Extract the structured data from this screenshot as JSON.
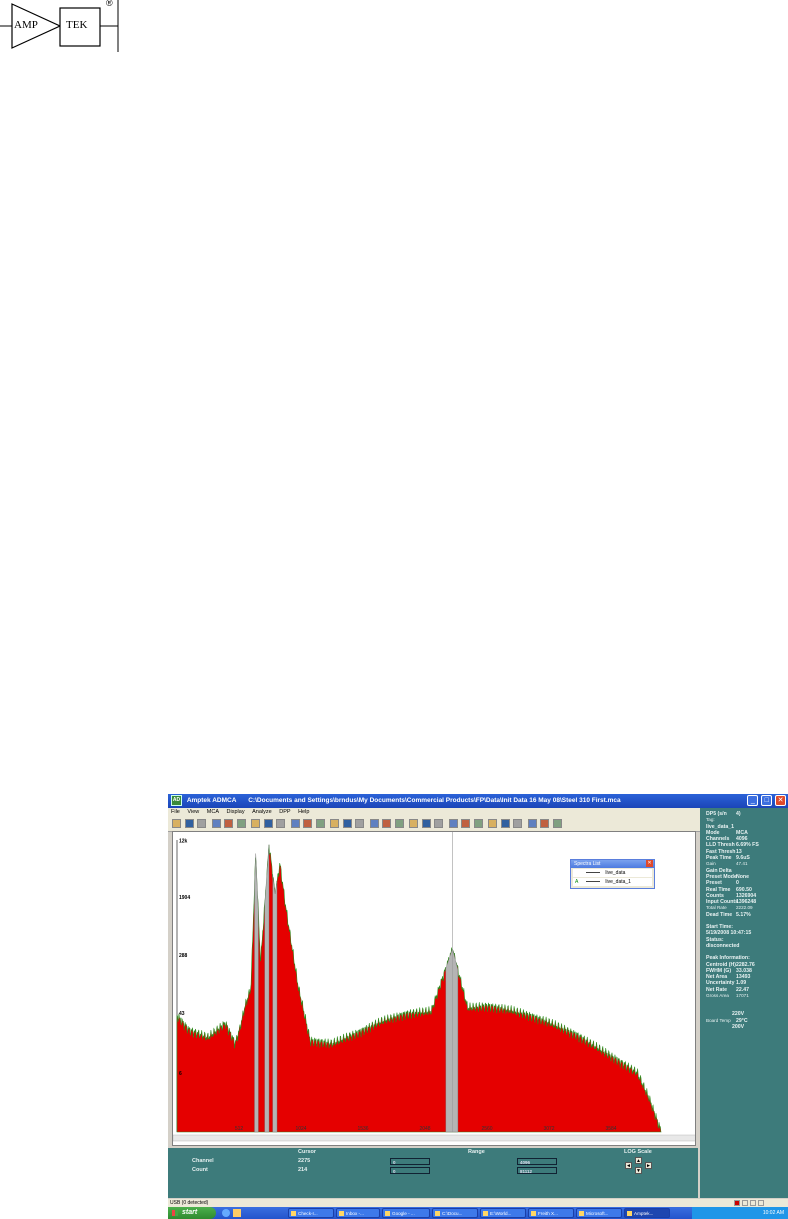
{
  "logo": {
    "left_text": "AMP",
    "right_text": "TEK",
    "registered_mark": "®"
  },
  "window": {
    "app_name": "Amptek ADMCA",
    "file_path": "C:\\Documents and Settings\\brndus\\My Documents\\Commercial Products\\FP\\Data\\Init Data 16 May 08\\Steel 310 First.mca",
    "icon": "app-icon",
    "controls": {
      "minimize": "_",
      "maximize": "□",
      "close": "✕"
    }
  },
  "menu": [
    "File",
    "View",
    "MCA",
    "Display",
    "Analyze",
    "DPP",
    "Help"
  ],
  "toolbar_count": 30,
  "spectra_list": {
    "title": "Spectra List",
    "items": [
      {
        "tag": "",
        "name": "live_data"
      },
      {
        "tag": "A",
        "name": "live_data_1"
      }
    ]
  },
  "colors": {
    "spectrum_fill": "#e50000",
    "spectrum_outline": "#2a8a1a",
    "roi_fill": "#b4b4b4",
    "panel": "#3d7b7b",
    "titlebar": "#1b45b8"
  },
  "chart_data": {
    "type": "area",
    "x_tick_labels": [
      "512",
      "1024",
      "1536",
      "2048",
      "2560",
      "3072",
      "3584"
    ],
    "y_tick_labels": [
      "12k",
      "1904",
      "288",
      "43",
      "6"
    ],
    "xlim": [
      0,
      4096
    ],
    "log_scale": true,
    "cursor_channel": 2275,
    "series": [
      {
        "name": "live_data",
        "description_points": [
          [
            0,
            45
          ],
          [
            100,
            28
          ],
          [
            256,
            22
          ],
          [
            400,
            35
          ],
          [
            480,
            18
          ],
          [
            520,
            30
          ],
          [
            560,
            60
          ],
          [
            610,
            110
          ],
          [
            650,
            9000
          ],
          [
            690,
            260
          ],
          [
            760,
            12000
          ],
          [
            810,
            2400
          ],
          [
            850,
            6500
          ],
          [
            900,
            1500
          ],
          [
            1000,
            120
          ],
          [
            1100,
            20
          ],
          [
            1280,
            18
          ],
          [
            1500,
            26
          ],
          [
            1700,
            38
          ],
          [
            1900,
            48
          ],
          [
            2100,
            52
          ],
          [
            2275,
            400
          ],
          [
            2400,
            58
          ],
          [
            2560,
            62
          ],
          [
            2750,
            54
          ],
          [
            2900,
            46
          ],
          [
            3072,
            36
          ],
          [
            3300,
            24
          ],
          [
            3584,
            12
          ],
          [
            3800,
            7
          ],
          [
            3900,
            3
          ],
          [
            4000,
            1
          ]
        ]
      }
    ],
    "rois": [
      {
        "start": 640,
        "end": 672
      },
      {
        "start": 724,
        "end": 760
      },
      {
        "start": 790,
        "end": 826
      },
      {
        "start": 2220,
        "end": 2320
      }
    ]
  },
  "info_panel": {
    "header": [
      {
        "k": "DP5 (s/n",
        "v": "4)"
      },
      {
        "k": "Tag:",
        "v": "",
        "small": true
      },
      {
        "k": "live_data_1",
        "v": ""
      },
      {
        "k": "Mode",
        "v": "MCA"
      },
      {
        "k": "Channels",
        "v": "4096"
      },
      {
        "k": "LLD Thresh",
        "v": "6.69% FS"
      },
      {
        "k": "Fast Thresh",
        "v": "13"
      },
      {
        "k": "Peak Time",
        "v": "9.6uS"
      },
      {
        "k": "Gain",
        "v": "47.41",
        "small": true
      },
      {
        "k": "Gain Delta",
        "v": ""
      },
      {
        "k": "Preset Mode",
        "v": "None"
      },
      {
        "k": "Preset",
        "v": "0"
      },
      {
        "k": "Real Time",
        "v": "690.50"
      },
      {
        "k": "Counts",
        "v": "1326904"
      },
      {
        "k": "Input Counts",
        "v": "1396248"
      },
      {
        "k": "Total Rate",
        "v": "2222.09",
        "small": true
      },
      {
        "k": "Dead Time",
        "v": "5.17%"
      }
    ],
    "start_time_label": "Start Time:",
    "start_time": "5/19/2008 10:47:15",
    "status_label": "Status:",
    "status": "disconnected",
    "peak_title": "Peak Information:",
    "peak": [
      {
        "k": "Centroid (H)",
        "v": "2282.76"
      },
      {
        "k": "FWHM (G)",
        "v": "33.038"
      },
      {
        "k": "Net Area",
        "v": "13493"
      },
      {
        "k": "Uncertainty",
        "v": "1.09"
      },
      {
        "k": "Net Rate",
        "v": "22.47"
      },
      {
        "k": "Gross Area",
        "v": "17071",
        "small": true
      }
    ],
    "hv": "220V",
    "board_temp_label": "Board Temp",
    "board_temp": "29°C",
    "det_temp": "200V"
  },
  "bottom_panel": {
    "cursor_label": "Cursor",
    "range_label": "Range",
    "log_label": "LOG Scale",
    "channel_label": "Channel",
    "count_label": "Count",
    "cursor_channel": "2275",
    "cursor_count": "214",
    "range_start": "0",
    "range_end": "4096",
    "range_count_start": "0",
    "range_count_end": "81112",
    "arrows": {
      "left": "◄",
      "up": "▲",
      "down": "▼",
      "right": "►"
    }
  },
  "status_bar": {
    "text": "USB (0 detected)"
  },
  "taskbar": {
    "start": "start",
    "tasks": [
      "Check-I...",
      "Inbox -...",
      "Google - ...",
      "C:\\Docu...",
      "E:\\World...",
      "Freith X...",
      "Microsoft...",
      "Amptek..."
    ],
    "clock": "10:02 AM"
  }
}
